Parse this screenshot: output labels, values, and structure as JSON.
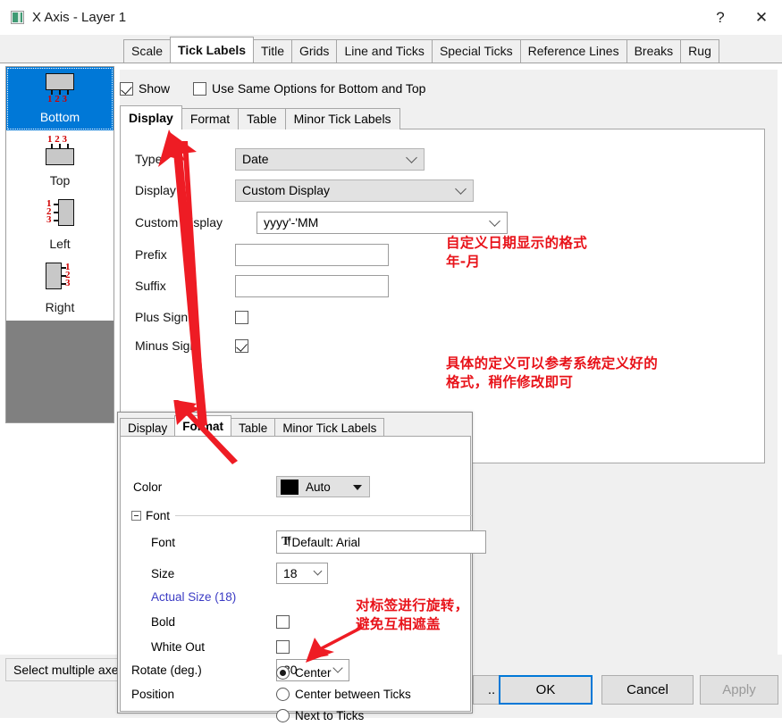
{
  "window": {
    "title": "X Axis - Layer 1",
    "icon": "origin-axis-icon",
    "help_label": "?",
    "close_label": "✕"
  },
  "tabs": [
    {
      "label": "Scale",
      "active": false
    },
    {
      "label": "Tick Labels",
      "active": true
    },
    {
      "label": "Title",
      "active": false
    },
    {
      "label": "Grids",
      "active": false
    },
    {
      "label": "Line and Ticks",
      "active": false
    },
    {
      "label": "Special Ticks",
      "active": false
    },
    {
      "label": "Reference Lines",
      "active": false
    },
    {
      "label": "Breaks",
      "active": false
    },
    {
      "label": "Rug",
      "active": false
    }
  ],
  "axis_list": [
    {
      "label": "Bottom",
      "selected": true
    },
    {
      "label": "Top",
      "selected": false
    },
    {
      "label": "Left",
      "selected": false
    },
    {
      "label": "Right",
      "selected": false
    }
  ],
  "options_row": {
    "show_label": "Show",
    "show_checked": true,
    "same_options_label": "Use Same Options for Bottom and Top",
    "same_options_checked": false
  },
  "inner_tabs": [
    {
      "label": "Display",
      "active": true
    },
    {
      "label": "Format",
      "active": false
    },
    {
      "label": "Table",
      "active": false
    },
    {
      "label": "Minor Tick Labels",
      "active": false
    }
  ],
  "display_pane": {
    "type_label": "Type",
    "type_value": "Date",
    "display_label": "Display",
    "display_value": "Custom Display",
    "custom_display_label": "Custom Display",
    "custom_display_value": "yyyy'-'MM",
    "prefix_label": "Prefix",
    "prefix_value": "",
    "suffix_label": "Suffix",
    "suffix_value": "",
    "plus_sign_label": "Plus Sign",
    "plus_sign_checked": false,
    "minus_sign_label": "Minus Sign",
    "minus_sign_checked": true
  },
  "annotations": [
    {
      "name": "custom-format-note",
      "text": "自定义日期显示的格式\n年-月",
      "color": "#e8131a"
    },
    {
      "name": "system-format-note",
      "text": "具体的定义可以参考系统定义好的\n格式，稍作修改即可",
      "color": "#e8131a"
    },
    {
      "name": "rotate-label-note",
      "text": "对标签进行旋转，\n避免互相遮盖",
      "color": "#e8131a"
    }
  ],
  "format_dialog": {
    "tabs": [
      {
        "label": "Display",
        "active": false
      },
      {
        "label": "Format",
        "active": true
      },
      {
        "label": "Table",
        "active": false
      },
      {
        "label": "Minor Tick Labels",
        "active": false
      }
    ],
    "color_label": "Color",
    "color_value": "Auto",
    "color_swatch": "#000000",
    "font_group_label": "Font",
    "font_label": "Font",
    "font_value": "Default: Arial",
    "size_label": "Size",
    "size_value": "18",
    "actual_size_label": "Actual Size (18)",
    "bold_label": "Bold",
    "bold_checked": false,
    "white_out_label": "White Out",
    "white_out_checked": false,
    "rotate_label": "Rotate (deg.)",
    "rotate_value": "30",
    "position_label": "Position",
    "position_options": [
      {
        "label": "Center",
        "selected": true
      },
      {
        "label": "Center between Ticks",
        "selected": false
      },
      {
        "label": "Next to Ticks",
        "selected": false
      }
    ]
  },
  "status_bar": {
    "text": "Select multiple axe"
  },
  "buttons": [
    {
      "label": "..",
      "name": "more-button",
      "state": "normal"
    },
    {
      "label": "OK",
      "name": "ok-button",
      "state": "focused"
    },
    {
      "label": "Cancel",
      "name": "cancel-button",
      "state": "normal"
    },
    {
      "label": "Apply",
      "name": "apply-button",
      "state": "disabled"
    }
  ]
}
